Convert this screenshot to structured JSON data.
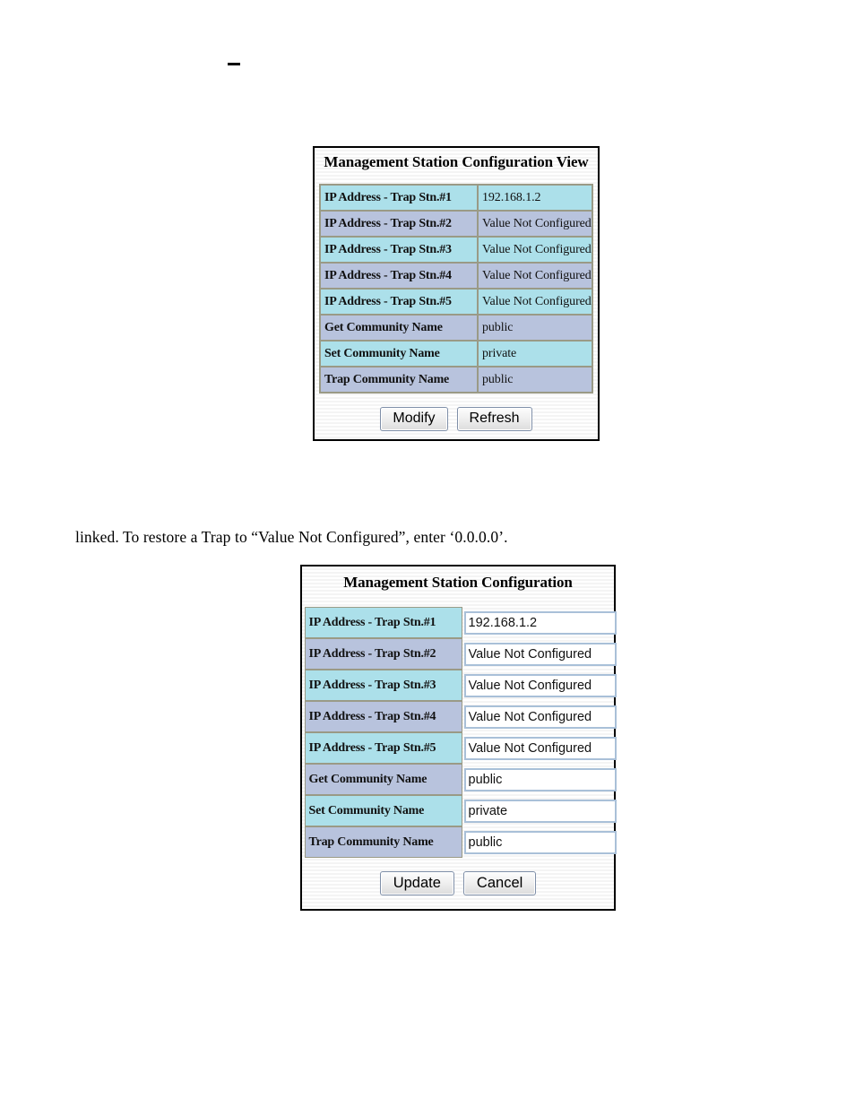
{
  "page": {
    "top_mark": "–",
    "paragraph": "linked.  To restore a Trap to “Value Not Configured”, enter ‘0.0.0.0’."
  },
  "colors": {
    "row_cyan": "#ace0ea",
    "row_blue": "#b8c3dd",
    "table_border": "#9a9a86",
    "input_border": "#a9c0d8",
    "panel_border": "#000000",
    "button_border": "#7f8fa8"
  },
  "view_panel": {
    "title": "Management Station Configuration View",
    "rows": [
      {
        "label": "IP Address - Trap Stn.#1",
        "value": "192.168.1.2",
        "stripe": "a"
      },
      {
        "label": "IP Address - Trap Stn.#2",
        "value": "Value Not Configured",
        "stripe": "b"
      },
      {
        "label": "IP Address - Trap Stn.#3",
        "value": "Value Not Configured",
        "stripe": "a"
      },
      {
        "label": "IP Address - Trap Stn.#4",
        "value": "Value Not Configured",
        "stripe": "b"
      },
      {
        "label": "IP Address - Trap Stn.#5",
        "value": "Value Not Configured",
        "stripe": "a"
      },
      {
        "label": "Get Community Name",
        "value": "public",
        "stripe": "b"
      },
      {
        "label": "Set Community Name",
        "value": "private",
        "stripe": "a"
      },
      {
        "label": "Trap Community Name",
        "value": "public",
        "stripe": "b"
      }
    ],
    "buttons": {
      "modify": "Modify",
      "refresh": "Refresh"
    }
  },
  "edit_panel": {
    "title": "Management Station Configuration",
    "rows": [
      {
        "label": "IP Address - Trap Stn.#1",
        "value": "192.168.1.2",
        "stripe": "a"
      },
      {
        "label": "IP Address - Trap Stn.#2",
        "value": "Value Not Configured",
        "stripe": "b"
      },
      {
        "label": "IP Address - Trap Stn.#3",
        "value": "Value Not Configured",
        "stripe": "a"
      },
      {
        "label": "IP Address - Trap Stn.#4",
        "value": "Value Not Configured",
        "stripe": "b"
      },
      {
        "label": "IP Address - Trap Stn.#5",
        "value": "Value Not Configured",
        "stripe": "a"
      },
      {
        "label": "Get Community Name",
        "value": "public",
        "stripe": "b"
      },
      {
        "label": "Set Community Name",
        "value": "private",
        "stripe": "a"
      },
      {
        "label": "Trap Community Name",
        "value": "public",
        "stripe": "b"
      }
    ],
    "buttons": {
      "update": "Update",
      "cancel": "Cancel"
    }
  }
}
